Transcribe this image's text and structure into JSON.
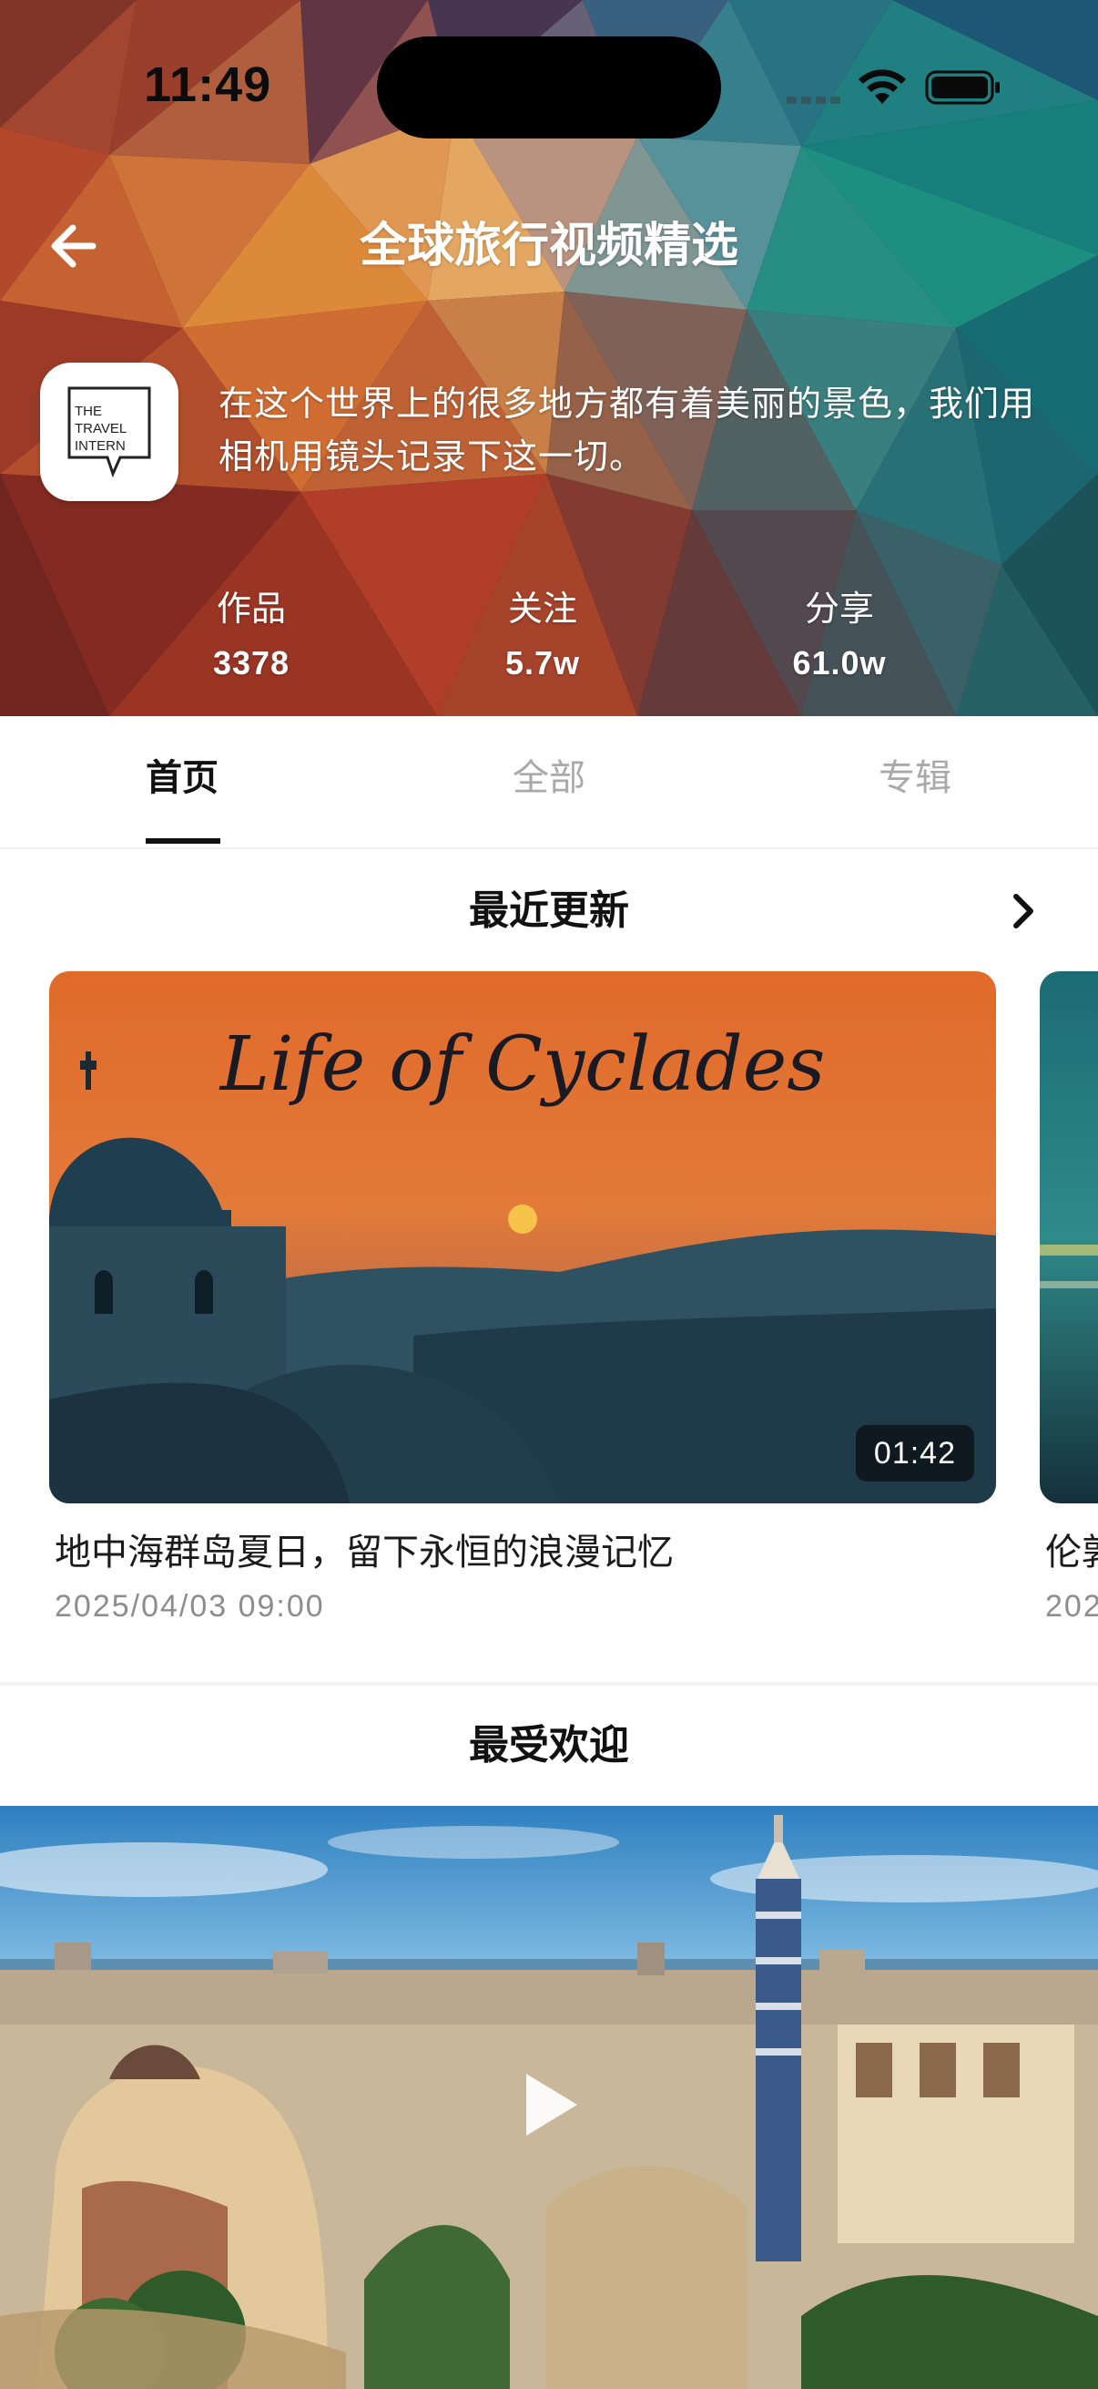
{
  "status_bar": {
    "time": "11:49"
  },
  "header": {
    "title": "全球旅行视频精选",
    "bio": "在这个世界上的很多地方都有着美丽的景色，我们用相机用镜头记录下这一切。",
    "avatar_logo_text": "THE TRAVEL INTERN",
    "stats": [
      {
        "label": "作品",
        "value": "3378"
      },
      {
        "label": "关注",
        "value": "5.7w"
      },
      {
        "label": "分享",
        "value": "61.0w"
      }
    ]
  },
  "tabs": [
    {
      "label": "首页",
      "active": true
    },
    {
      "label": "全部",
      "active": false
    },
    {
      "label": "专辑",
      "active": false
    }
  ],
  "recent": {
    "title": "最近更新",
    "videos": [
      {
        "thumb_text": "Life of Cyclades",
        "duration": "01:42",
        "title": "地中海群岛夏日，留下永恒的浪漫记忆",
        "date": "2025/04/03 09:00"
      },
      {
        "title": "伦敦",
        "date": "202"
      }
    ]
  },
  "popular": {
    "title": "最受欢迎"
  },
  "icons": {
    "back": "arrow-left-icon",
    "more": "chevron-right-icon",
    "play": "play-icon",
    "wifi": "wifi-icon",
    "battery": "battery-icon",
    "signal": "cellular-signal-icon"
  },
  "colors": {
    "tab_active": "#111111",
    "tab_inactive": "#a9a9a9",
    "date": "#8d8d8d"
  }
}
